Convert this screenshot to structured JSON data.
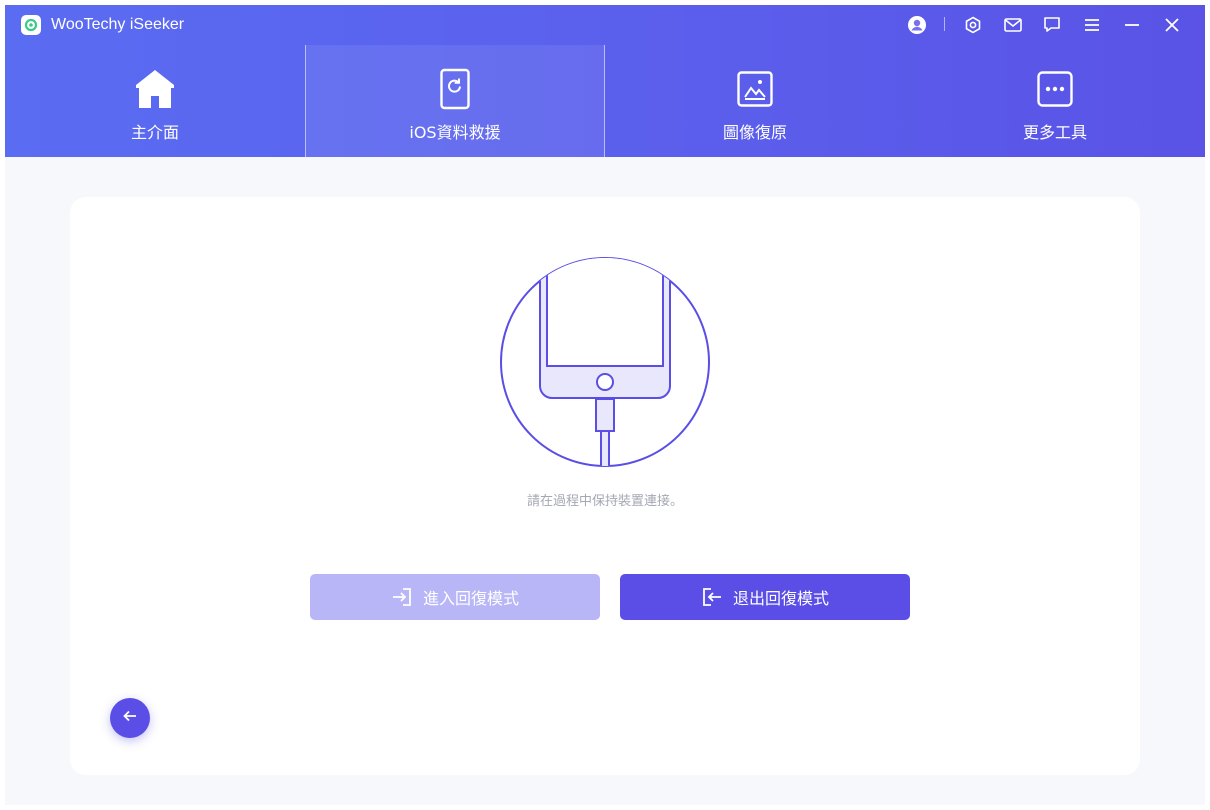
{
  "app": {
    "title": "WooTechy iSeeker"
  },
  "titlebar": {
    "icons": [
      "account-icon",
      "settings-icon",
      "mail-icon",
      "feedback-icon",
      "menu-icon",
      "minimize-icon",
      "close-icon"
    ]
  },
  "tabs": [
    {
      "label": "主介面",
      "icon": "home-icon",
      "active": false
    },
    {
      "label": "iOS資料救援",
      "icon": "phone-refresh-icon",
      "active": true
    },
    {
      "label": "圖像復原",
      "icon": "image-icon",
      "active": false
    },
    {
      "label": "更多工具",
      "icon": "more-icon",
      "active": false
    }
  ],
  "main": {
    "hint": "請在過程中保持裝置連接。",
    "enter_button": "進入回復模式",
    "exit_button": "退出回復模式"
  },
  "colors": {
    "header_start": "#5a6cf2",
    "header_end": "#5a53e6",
    "accent": "#5a4ee6",
    "button_disabled": "#b8b6f6",
    "background": "#f7f8fc"
  }
}
